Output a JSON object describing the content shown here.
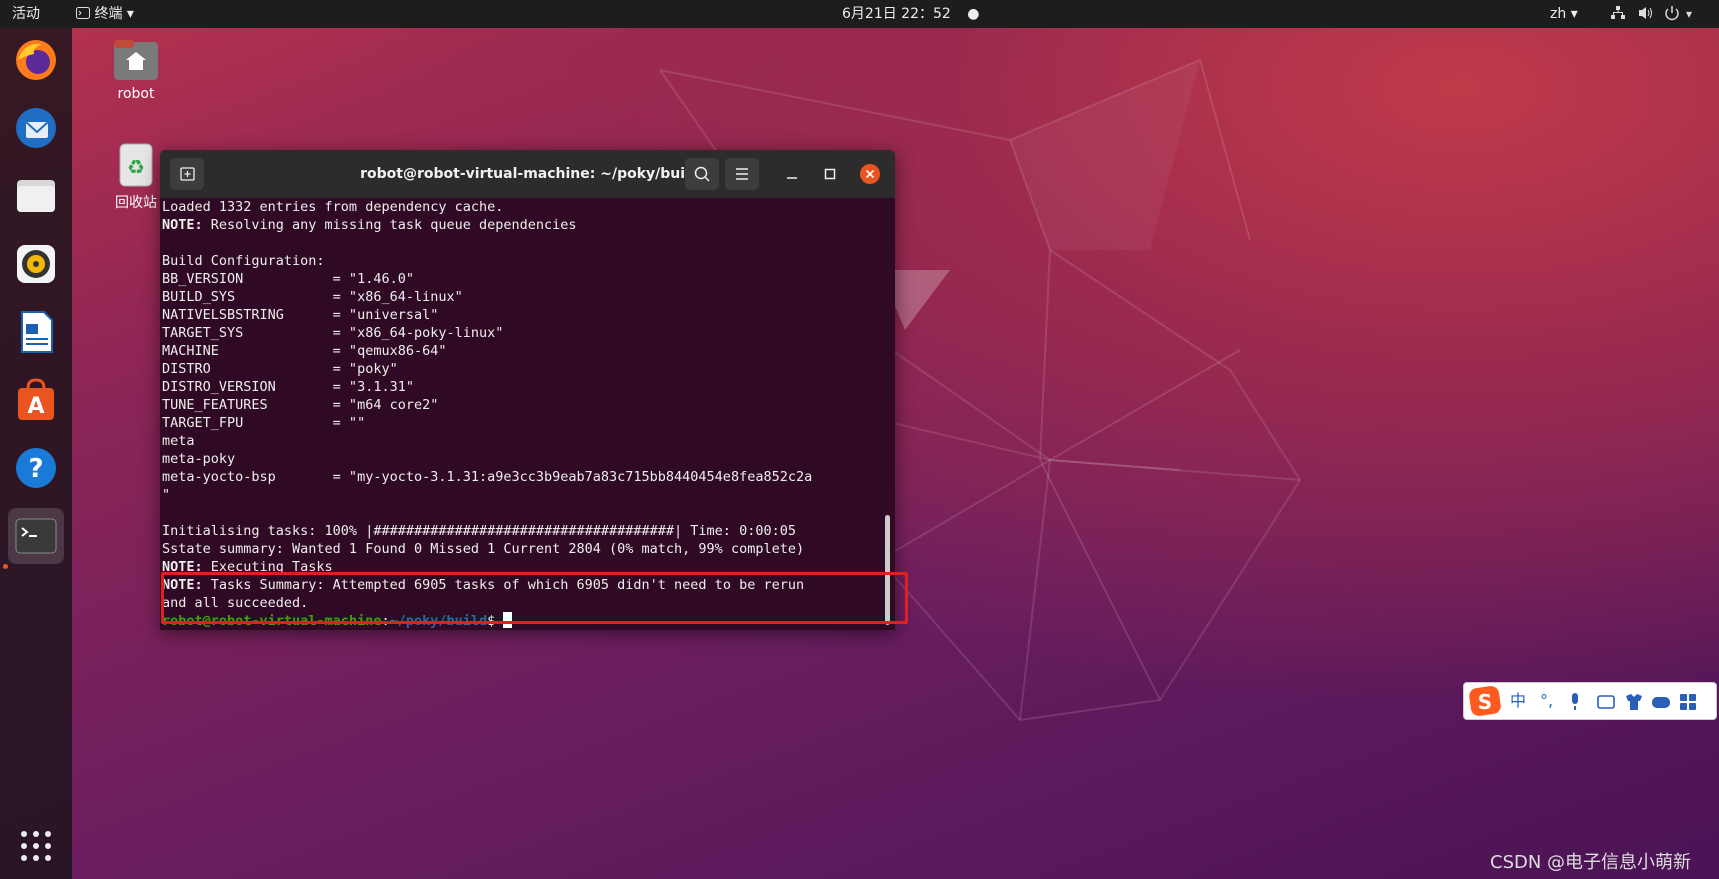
{
  "topbar": {
    "activities": "活动",
    "app_menu": "终端",
    "clock": "6月21日  22：52",
    "lang": "zh"
  },
  "desktop_icons": [
    {
      "label": "robot"
    },
    {
      "label": "回收站"
    }
  ],
  "terminal": {
    "title": "robot@robot-virtual-machine: ~/poky/build",
    "lines": [
      {
        "text": "Loaded 1332 entries from dependency cache."
      },
      {
        "prefix": "NOTE:",
        "text": " Resolving any missing task queue dependencies"
      },
      {
        "text": ""
      },
      {
        "text": "Build Configuration:"
      },
      {
        "text": "BB_VERSION           = \"1.46.0\""
      },
      {
        "text": "BUILD_SYS            = \"x86_64-linux\""
      },
      {
        "text": "NATIVELSBSTRING      = \"universal\""
      },
      {
        "text": "TARGET_SYS           = \"x86_64-poky-linux\""
      },
      {
        "text": "MACHINE              = \"qemux86-64\""
      },
      {
        "text": "DISTRO               = \"poky\""
      },
      {
        "text": "DISTRO_VERSION       = \"3.1.31\""
      },
      {
        "text": "TUNE_FEATURES        = \"m64 core2\""
      },
      {
        "text": "TARGET_FPU           = \"\""
      },
      {
        "text": "meta"
      },
      {
        "text": "meta-poky"
      },
      {
        "text": "meta-yocto-bsp       = \"my-yocto-3.1.31:a9e3cc3b9eab7a83c715bb8440454e8fea852c2a"
      },
      {
        "text": "\""
      },
      {
        "text": ""
      },
      {
        "text": "Initialising tasks: 100% |#####################################| Time: 0:00:05"
      },
      {
        "text": "Sstate summary: Wanted 1 Found 0 Missed 1 Current 2804 (0% match, 99% complete)"
      },
      {
        "prefix": "NOTE:",
        "text": " Executing Tasks"
      },
      {
        "prefix": "NOTE:",
        "text": " Tasks Summary: Attempted 6905 tasks of which 6905 didn't need to be rerun"
      },
      {
        "text": "and all succeeded."
      }
    ],
    "prompt_user": "robot@robot-virtual-machine",
    "prompt_sep": ":",
    "prompt_path": "~/poky/build",
    "prompt_end": "$ "
  },
  "ime": {
    "mode": "中",
    "punct": "°,"
  },
  "watermark": "CSDN @电子信息小萌新",
  "colors": {
    "ubuntu_orange": "#e95420",
    "terminal_bg": "#300a24",
    "highlight": "#e0201c"
  }
}
